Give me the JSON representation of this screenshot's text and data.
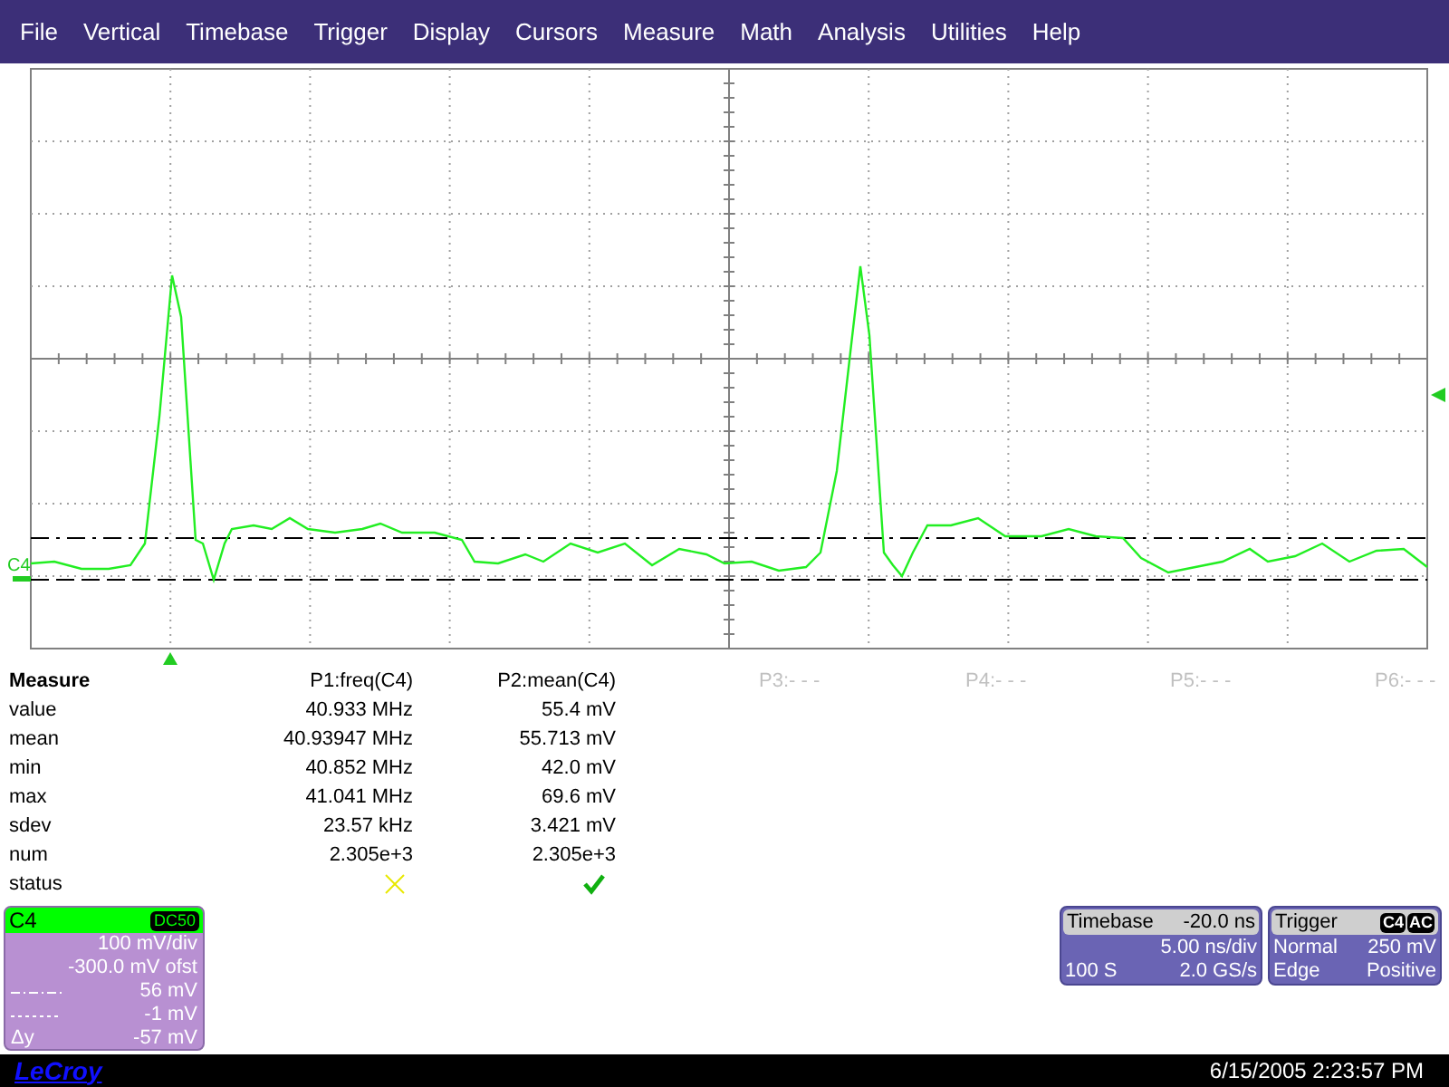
{
  "menu": [
    "File",
    "Vertical",
    "Timebase",
    "Trigger",
    "Display",
    "Cursors",
    "Measure",
    "Math",
    "Analysis",
    "Utilities",
    "Help"
  ],
  "scope": {
    "channel_label": "C4"
  },
  "measure": {
    "title": "Measure",
    "columns": [
      {
        "label": "P1:freq(C4)",
        "enabled": true
      },
      {
        "label": "P2:mean(C4)",
        "enabled": true
      },
      {
        "label": "P3:- - -",
        "enabled": false
      },
      {
        "label": "P4:- - -",
        "enabled": false
      },
      {
        "label": "P5:- - -",
        "enabled": false
      },
      {
        "label": "P6:- - -",
        "enabled": false
      }
    ],
    "rows": [
      {
        "label": "value",
        "values": [
          "40.933 MHz",
          "55.4 mV"
        ]
      },
      {
        "label": "mean",
        "values": [
          "40.93947 MHz",
          "55.713 mV"
        ]
      },
      {
        "label": "min",
        "values": [
          "40.852 MHz",
          "42.0 mV"
        ]
      },
      {
        "label": "max",
        "values": [
          "41.041 MHz",
          "69.6 mV"
        ]
      },
      {
        "label": "sdev",
        "values": [
          "23.57 kHz",
          "3.421 mV"
        ]
      },
      {
        "label": "num",
        "values": [
          "2.305e+3",
          "2.305e+3"
        ]
      }
    ],
    "status": {
      "label": "status",
      "values": [
        {
          "ok": false
        },
        {
          "ok": true
        }
      ]
    }
  },
  "channel_panel": {
    "name": "C4",
    "coupling": "DC50",
    "lines": [
      {
        "kind": "text",
        "value": "100 mV/div"
      },
      {
        "kind": "text",
        "value": "-300.0 mV ofst"
      },
      {
        "kind": "dashdot",
        "value": "56 mV"
      },
      {
        "kind": "dotted",
        "value": "-1 mV"
      },
      {
        "kind": "label",
        "label": "Δy",
        "value": "-57 mV"
      }
    ]
  },
  "timebase_panel": {
    "title": "Timebase",
    "title_value": "-20.0 ns",
    "rows": [
      {
        "right": "5.00 ns/div"
      },
      {
        "left": "100 S",
        "right": "2.0 GS/s"
      }
    ]
  },
  "trigger_panel": {
    "title": "Trigger",
    "badges": [
      "C4",
      "AC"
    ],
    "rows": [
      {
        "left": "Normal",
        "right": "250 mV"
      },
      {
        "left": "Edge",
        "right": "Positive"
      }
    ]
  },
  "footer": {
    "logo": "LeCroy",
    "datetime": "6/15/2005 2:23:57 PM"
  }
}
